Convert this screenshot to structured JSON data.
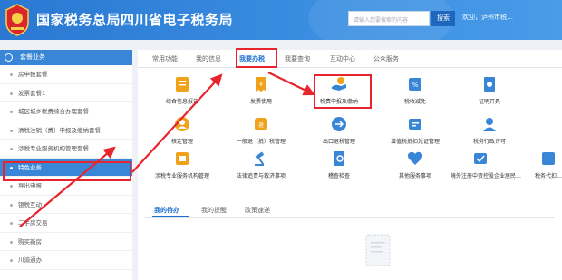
{
  "header": {
    "title": "国家税务总局四川省电子税务局",
    "search_placeholder": "请输入您要搜索的内容",
    "search_button": "搜索",
    "welcome": "欢迎，泸州市税…"
  },
  "sidebar": {
    "heading": "套餐业务",
    "items": [
      {
        "label": "房申报套餐",
        "active": false
      },
      {
        "label": "发票套餐1",
        "active": false
      },
      {
        "label": "城区城乡税费综合办理套餐",
        "active": false
      },
      {
        "label": "清税注销（费）申报及缴纳套餐",
        "active": false
      },
      {
        "label": "涉税专业服务机构管理套餐",
        "active": false
      },
      {
        "label": "特色业务",
        "active": true
      },
      {
        "label": "导出申报",
        "active": false
      },
      {
        "label": "银税互动",
        "active": false
      },
      {
        "label": "二手房交易",
        "active": false
      },
      {
        "label": "购买新房",
        "active": false
      },
      {
        "label": "川渝通办",
        "active": false
      }
    ]
  },
  "main": {
    "tabs": [
      {
        "label": "常用功能",
        "active": false
      },
      {
        "label": "我的信息",
        "active": false
      },
      {
        "label": "我要办税",
        "active": true
      },
      {
        "label": "我要查询",
        "active": false
      },
      {
        "label": "互动中心",
        "active": false
      },
      {
        "label": "公众服务",
        "active": false
      }
    ],
    "functions": [
      {
        "label": "综合信息报告",
        "icon": "info-report-icon",
        "color": "#f0a21a"
      },
      {
        "label": "发票使用",
        "icon": "invoice-icon",
        "color": "#f0a21a"
      },
      {
        "label": "税费申报及缴纳",
        "icon": "tax-declare-icon",
        "color": "#3a86d6"
      },
      {
        "label": "税收减免",
        "icon": "tax-relief-icon",
        "color": "#3a86d6"
      },
      {
        "label": "证明开具",
        "icon": "certificate-icon",
        "color": "#3a86d6"
      },
      {
        "label": "核定管理",
        "icon": "approval-icon",
        "color": "#f0a21a"
      },
      {
        "label": "一般退（抵）税管理",
        "icon": "refund-icon",
        "color": "#f0a21a"
      },
      {
        "label": "出口退税管理",
        "icon": "export-refund-icon",
        "color": "#3a86d6"
      },
      {
        "label": "增值税抵扣凭证管理",
        "icon": "vat-voucher-icon",
        "color": "#3a86d6"
      },
      {
        "label": "税务行政许可",
        "icon": "admin-license-icon",
        "color": "#3a86d6"
      },
      {
        "label": "涉税专业服务机构管理",
        "icon": "agency-icon",
        "color": "#f0a21a"
      },
      {
        "label": "法律追责与救济事项",
        "icon": "legal-icon",
        "color": "#3a86d6"
      },
      {
        "label": "稽查检查",
        "icon": "inspection-icon",
        "color": "#3a86d6"
      },
      {
        "label": "其他服务事项",
        "icon": "other-service-icon",
        "color": "#3a86d6"
      },
      {
        "label": "境外注册中资控股企业居民…",
        "icon": "overseas-icon",
        "color": "#3a86d6"
      },
      {
        "label": "税务代扣…",
        "icon": "withholding-icon",
        "color": "#3a86d6"
      }
    ],
    "lower_tabs": [
      {
        "label": "我的待办",
        "active": true
      },
      {
        "label": "我的提醒",
        "active": false
      },
      {
        "label": "政策速递",
        "active": false
      }
    ]
  },
  "colors": {
    "header": "#2a78d2",
    "accent": "#1f6fd0",
    "highlight": "#e8242c",
    "icon_orange": "#f0a21a",
    "icon_blue": "#3a86d6"
  }
}
